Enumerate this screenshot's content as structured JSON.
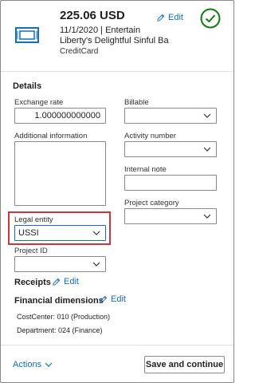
{
  "expense": {
    "amount": "225.06 USD",
    "date_category": "11/1/2020 | Entertain",
    "merchant": "Liberty's Delightful Sinful Ba",
    "payment_method": "CreditCard",
    "edit_label": "Edit"
  },
  "details": {
    "section_title": "Details",
    "exchange_rate_label": "Exchange rate",
    "exchange_rate_value": "1.000000000000",
    "billable_label": "Billable",
    "additional_info_label": "Additional information",
    "activity_number_label": "Activity number",
    "internal_note_label": "Internal note",
    "project_category_label": "Project category",
    "legal_entity_label": "Legal entity",
    "legal_entity_value": "USSI",
    "project_id_label": "Project ID"
  },
  "receipts": {
    "title": "Receipts",
    "edit_label": "Edit"
  },
  "financial_dimensions": {
    "title": "Financial dimensions",
    "edit_label": "Edit",
    "items": [
      "CostCenter: 010 (Production)",
      "Department: 024 (Finance)"
    ]
  },
  "footer": {
    "actions_label": "Actions",
    "save_label": "Save and continue"
  },
  "colors": {
    "accent": "#106ebe",
    "check": "#107c10",
    "highlight": "#d13438"
  }
}
